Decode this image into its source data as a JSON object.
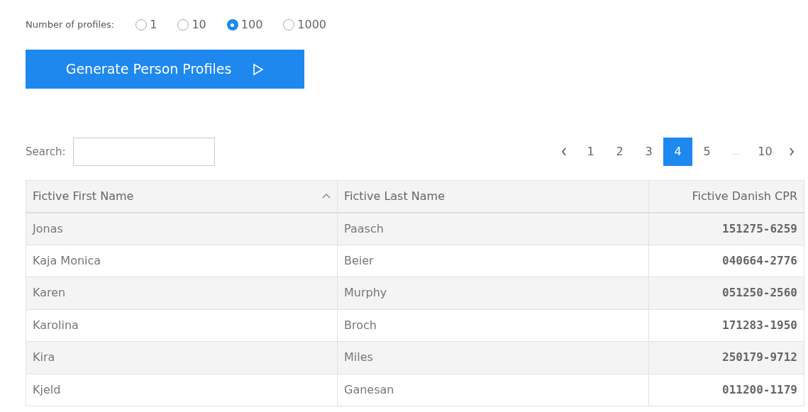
{
  "profile_count": {
    "label": "Number of profiles:",
    "options": [
      {
        "label": "1",
        "selected": false
      },
      {
        "label": "10",
        "selected": false
      },
      {
        "label": "100",
        "selected": true
      },
      {
        "label": "1000",
        "selected": false
      }
    ]
  },
  "generate_button": {
    "label": "Generate Person Profiles"
  },
  "search": {
    "label": "Search:"
  },
  "pagination": {
    "pages": [
      {
        "label": "1",
        "selected": false,
        "kind": "page"
      },
      {
        "label": "2",
        "selected": false,
        "kind": "page"
      },
      {
        "label": "3",
        "selected": false,
        "kind": "page"
      },
      {
        "label": "4",
        "selected": true,
        "kind": "page"
      },
      {
        "label": "5",
        "selected": false,
        "kind": "page"
      },
      {
        "label": "…",
        "kind": "ellipsis"
      },
      {
        "label": "10",
        "selected": false,
        "kind": "page"
      }
    ]
  },
  "table": {
    "columns": [
      {
        "label": "Fictive First Name",
        "sorted": true
      },
      {
        "label": "Fictive Last Name",
        "sorted": false
      },
      {
        "label": "Fictive Danish CPR",
        "sorted": false
      }
    ],
    "rows": [
      [
        "Jonas",
        "Paasch",
        "151275-6259"
      ],
      [
        "Kaja Monica",
        "Beier",
        "040664-2776"
      ],
      [
        "Karen",
        "Murphy",
        "051250-2560"
      ],
      [
        "Karolina",
        "Broch",
        "171283-1950"
      ],
      [
        "Kira",
        "Miles",
        "250179-9712"
      ],
      [
        "Kjeld",
        "Ganesan",
        "011200-1179"
      ]
    ]
  }
}
